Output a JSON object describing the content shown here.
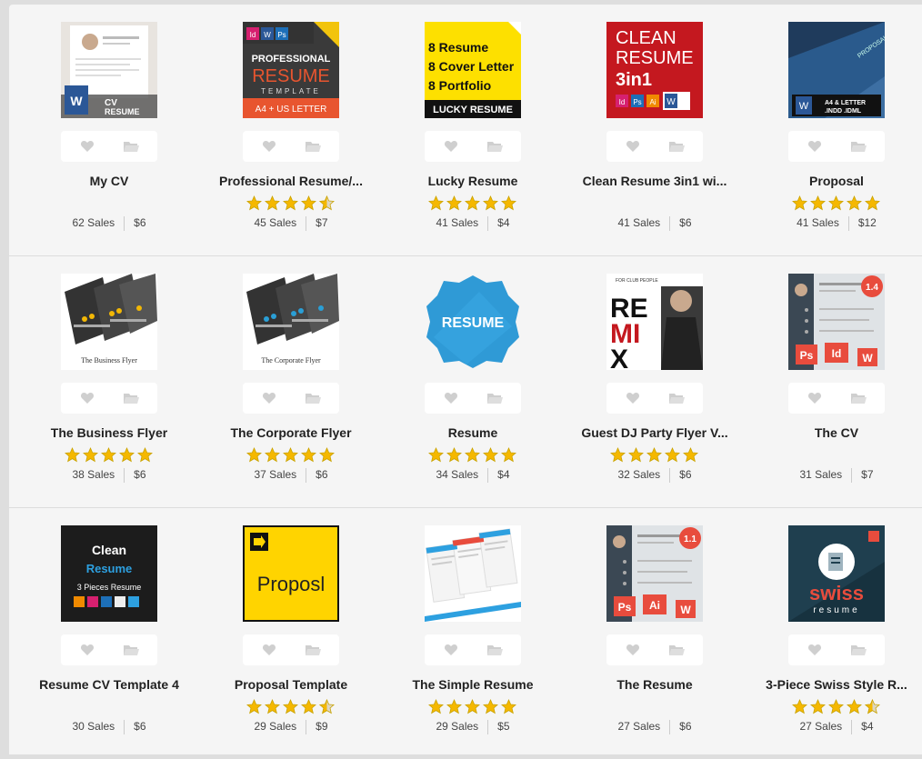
{
  "rows": [
    [
      {
        "title": "My CV",
        "sales": "62 Sales",
        "price": "$6",
        "rating": null,
        "thumb": {
          "kind": "doc",
          "badge": "CV\nRESUME"
        }
      },
      {
        "title": "Professional Resume/...",
        "sales": "45 Sales",
        "price": "$7",
        "rating": 4.5,
        "thumb": {
          "kind": "pro",
          "line1": "PROFESSIONAL",
          "line2": "RESUME",
          "line3": "TEMPLATE",
          "line4": "A4 + US LETTER"
        }
      },
      {
        "title": "Lucky Resume",
        "sales": "41 Sales",
        "price": "$4",
        "rating": 5,
        "thumb": {
          "kind": "lucky",
          "lines": [
            "8 Resume",
            "8 Cover Letter",
            "8 Portfolio"
          ],
          "footer": "LUCKY RESUME"
        }
      },
      {
        "title": "Clean Resume 3in1 wi...",
        "sales": "41 Sales",
        "price": "$6",
        "rating": null,
        "thumb": {
          "kind": "clean3",
          "lines": [
            "CLEAN",
            "RESUME",
            "3in1"
          ]
        }
      },
      {
        "title": "Proposal",
        "sales": "41 Sales",
        "price": "$12",
        "rating": 5,
        "thumb": {
          "kind": "proposal",
          "badge": "A4 & LETTER\n.INDD .IDML"
        }
      }
    ],
    [
      {
        "title": "The Business Flyer",
        "sales": "38 Sales",
        "price": "$6",
        "rating": 5,
        "thumb": {
          "kind": "flyer",
          "caption": "The Business Flyer",
          "accent": "#f2b705"
        }
      },
      {
        "title": "The Corporate Flyer",
        "sales": "37 Sales",
        "price": "$6",
        "rating": 5,
        "thumb": {
          "kind": "flyer",
          "caption": "The Corporate Flyer",
          "accent": "#2a9fd6"
        }
      },
      {
        "title": "Resume",
        "sales": "34 Sales",
        "price": "$4",
        "rating": 5,
        "thumb": {
          "kind": "badge",
          "text": "RESUME"
        }
      },
      {
        "title": "Guest DJ Party Flyer V...",
        "sales": "32 Sales",
        "price": "$6",
        "rating": 5,
        "thumb": {
          "kind": "remix",
          "text": "REMIX",
          "top": "FOR CLUB PEOPLE"
        }
      },
      {
        "title": "The CV",
        "sales": "31 Sales",
        "price": "$7",
        "rating": null,
        "thumb": {
          "kind": "cvapps",
          "version": "1.4",
          "apps": [
            "Ps",
            "Id",
            "W"
          ]
        }
      }
    ],
    [
      {
        "title": "Resume CV Template 4",
        "sales": "30 Sales",
        "price": "$6",
        "rating": null,
        "thumb": {
          "kind": "darkclean",
          "lines": [
            "Clean",
            "Resume",
            "3 Pieces Resume"
          ]
        }
      },
      {
        "title": "Proposal Template",
        "sales": "29 Sales",
        "price": "$9",
        "rating": 4.5,
        "thumb": {
          "kind": "yellowprop",
          "text": "Proposl"
        }
      },
      {
        "title": "The Simple Resume",
        "sales": "29 Sales",
        "price": "$5",
        "rating": 5,
        "thumb": {
          "kind": "simple"
        }
      },
      {
        "title": "The Resume",
        "sales": "27 Sales",
        "price": "$6",
        "rating": null,
        "thumb": {
          "kind": "cvapps",
          "version": "1.1",
          "apps": [
            "Ps",
            "Ai",
            "W"
          ]
        }
      },
      {
        "title": "3-Piece Swiss Style R...",
        "sales": "27 Sales",
        "price": "$4",
        "rating": 4.5,
        "thumb": {
          "kind": "swiss",
          "text": "swiss",
          "sub": "resume"
        }
      }
    ]
  ],
  "colors": {
    "star": "#f5b800",
    "heart": "#cfcfcf",
    "folder": "#cfcfcf"
  },
  "icons": {
    "like": "heart-icon",
    "collect": "folder-icon",
    "star": "star-icon"
  }
}
